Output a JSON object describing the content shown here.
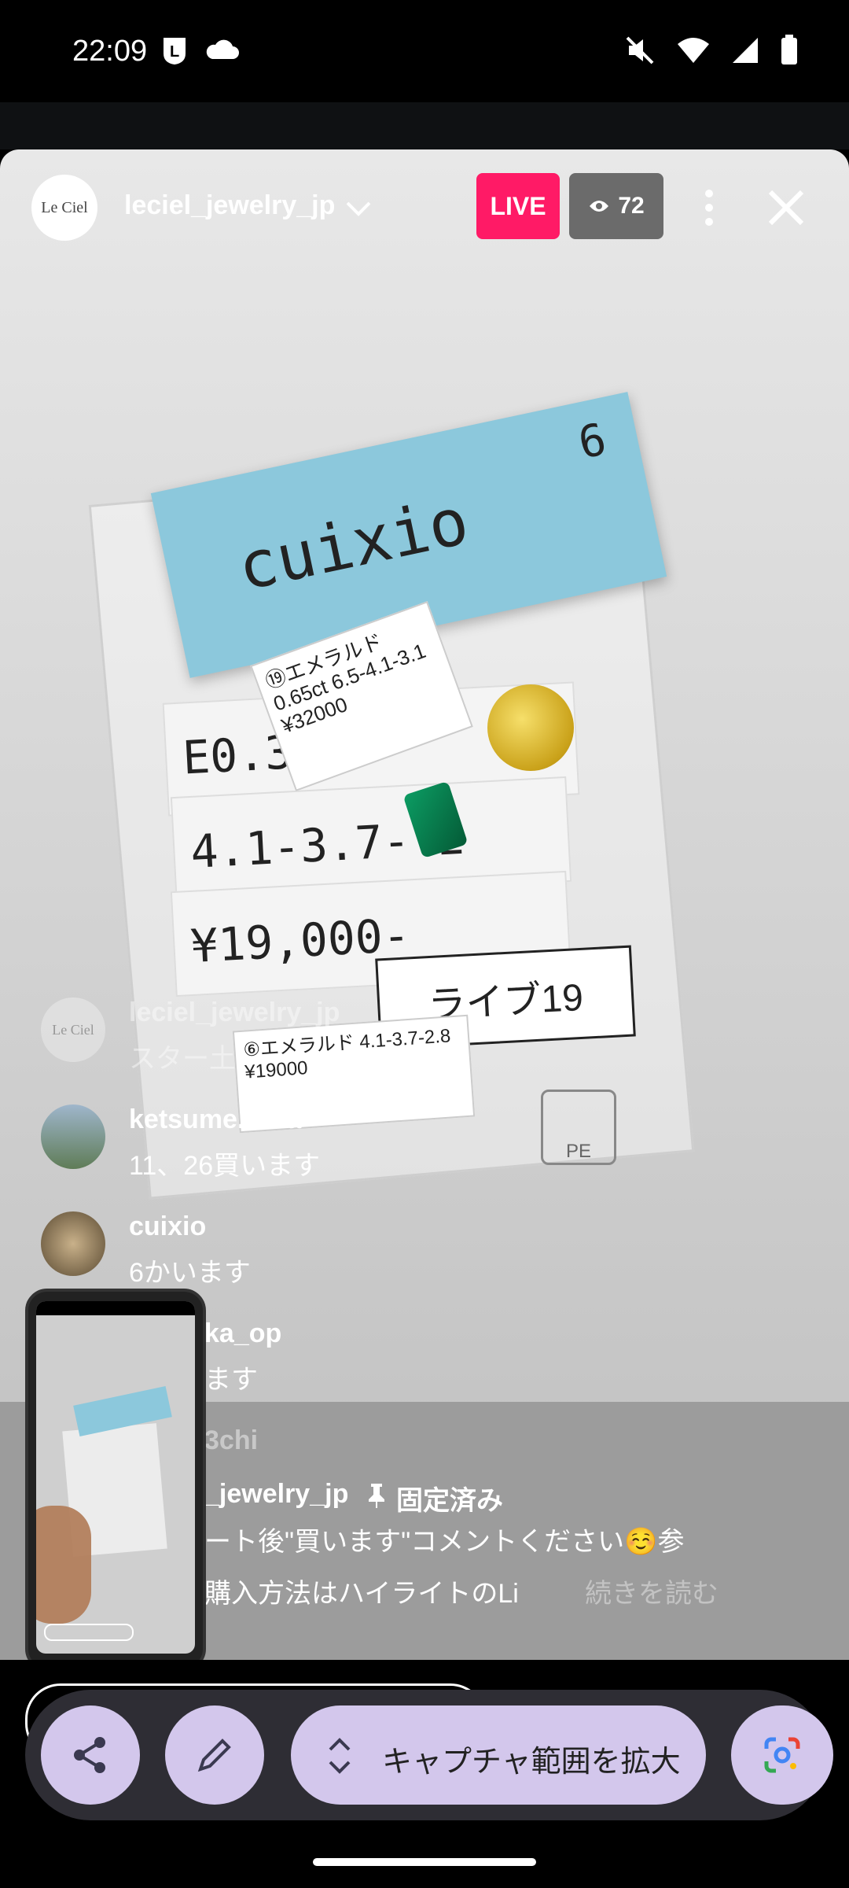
{
  "status_bar": {
    "time": "22:09"
  },
  "stream": {
    "username": "leciel_jewelry_jp",
    "avatar_text": "Le Ciel",
    "live_label": "LIVE",
    "viewers": "72"
  },
  "scene": {
    "blue_note": "cuixio",
    "blue_number": "6",
    "label_top": "E0.32",
    "label_mid": "4.1-3.7- 2",
    "label_bot": "¥19,000-",
    "tag_emerald": "⑲エメラルド0.65ct 6.5-4.1-3.1 ¥32000",
    "tag_live": "ライブ19",
    "tag_second": "⑥エメラルド 4.1-3.7-2.8 ¥19000",
    "pe_mark": "PE"
  },
  "comments": [
    {
      "user": "leciel_jewelry_jp",
      "text": "スター土"
    },
    {
      "user": "ketsume.sora",
      "text": "11、26買います"
    },
    {
      "user": "cuixio",
      "text": "6かいます"
    },
    {
      "user": "ka_op",
      "text": "ます"
    },
    {
      "user": "3chi",
      "text": ""
    },
    {
      "user": "_jewelry_jp",
      "pinned": "固定済み",
      "text": "ート後\"買います\"コメントください☺️参",
      "text2": "購入方法はハイライトのLi",
      "more": "続きを読む"
    }
  ],
  "capture_toolbar": {
    "expand_label": "キャプチャ範囲を拡大"
  }
}
